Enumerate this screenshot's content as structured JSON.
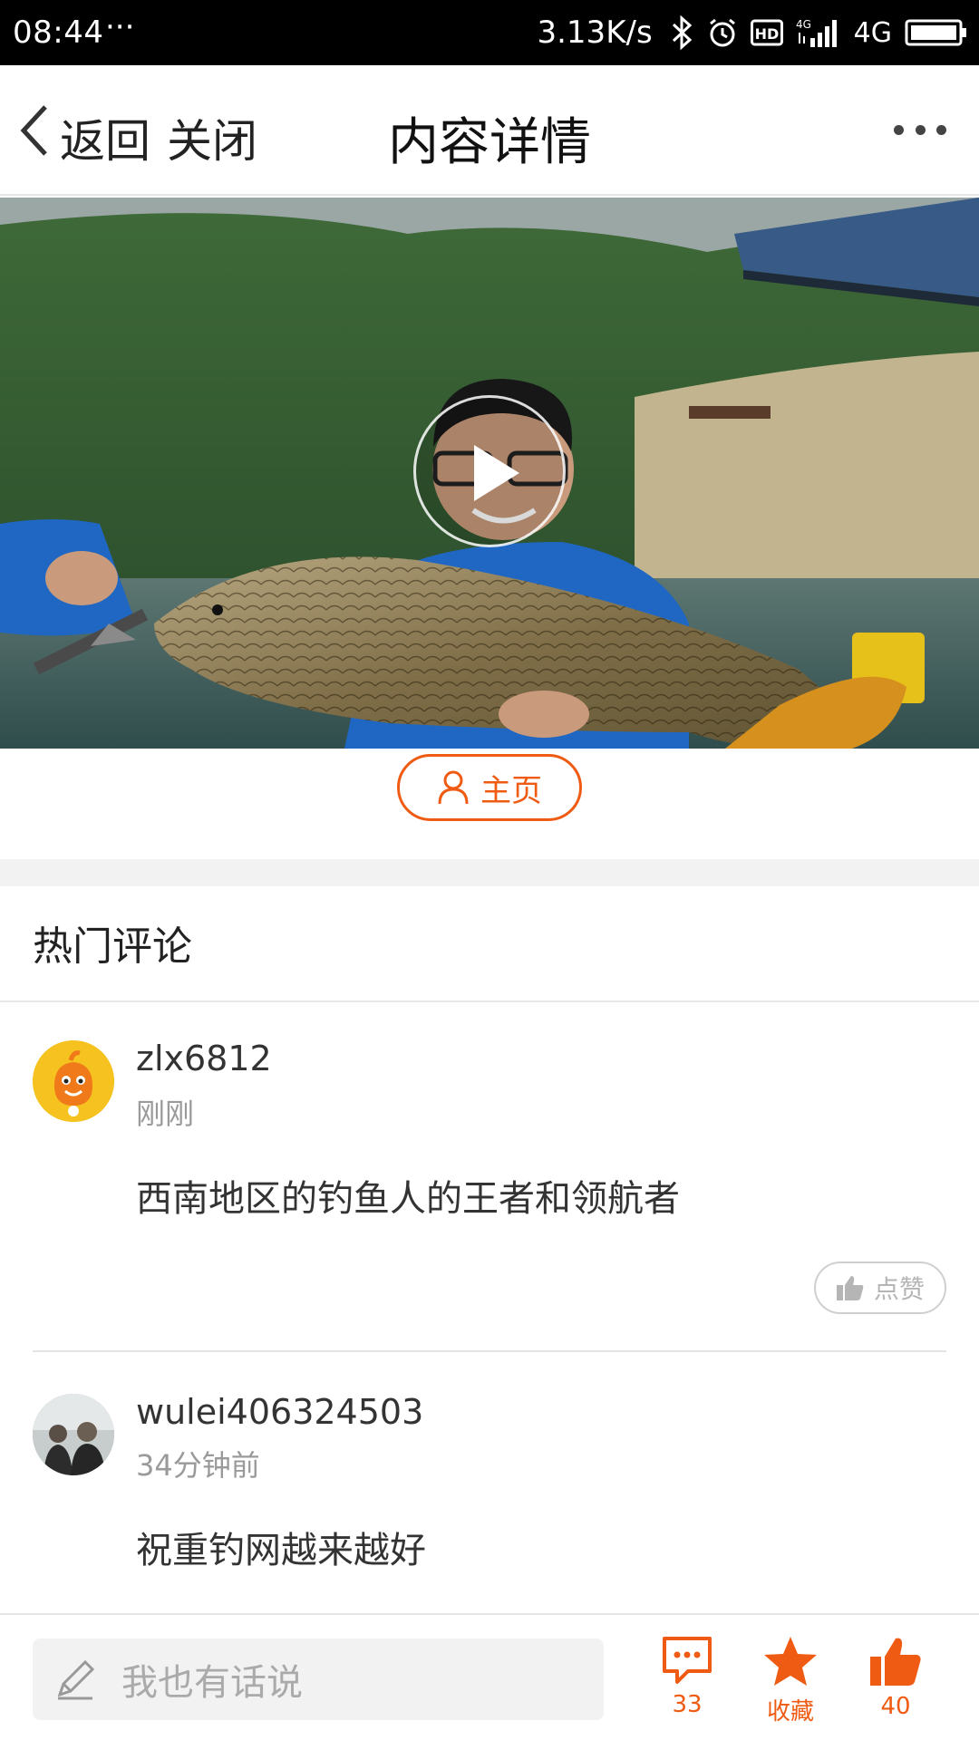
{
  "status_bar": {
    "time": "08:44",
    "dots": "···",
    "speed": "3.13K/s",
    "network": "4G",
    "hd": "HD"
  },
  "nav": {
    "back_label": "返回",
    "close_label": "关闭",
    "title": "内容详情",
    "more_icon": "more-dots-icon"
  },
  "video": {
    "play_icon": "play-icon"
  },
  "home_button": {
    "label": "主页",
    "icon": "user-icon"
  },
  "hot_comments": {
    "title": "热门评论",
    "items": [
      {
        "user": "zlx6812",
        "time": "刚刚",
        "text": "西南地区的钓鱼人的王者和领航者",
        "like_label": "点赞"
      },
      {
        "user": "wulei406324503",
        "time": "34分钟前",
        "text": "祝重钓网越来越好"
      }
    ]
  },
  "bottom_bar": {
    "input_placeholder": "我也有话说",
    "comment_count": "33",
    "favorite_label": "收藏",
    "like_count": "40"
  },
  "colors": {
    "accent": "#ef5b12",
    "muted": "#9a9a9a",
    "divider": "#e3e3e3"
  }
}
